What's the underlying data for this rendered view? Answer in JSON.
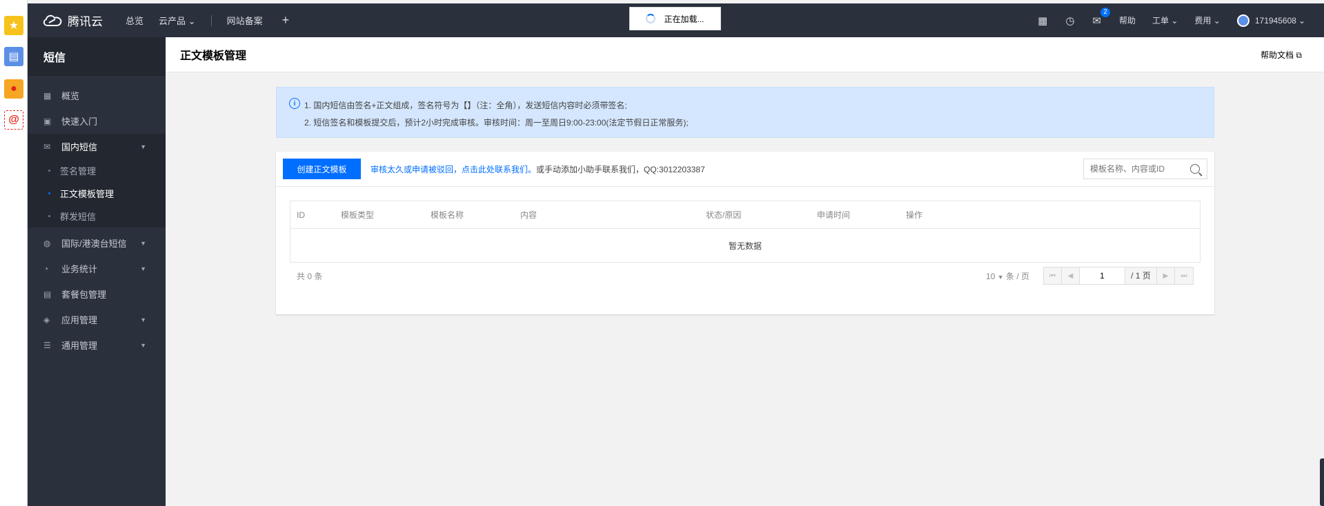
{
  "app_strip": {
    "icons": [
      "star-icon",
      "news-icon",
      "weibo-icon",
      "email-icon"
    ]
  },
  "topbar": {
    "logo_text": "腾讯云",
    "nav": [
      "总览",
      "云产品",
      "网站备案"
    ],
    "loading_text": "正在加载...",
    "mail_badge": "2",
    "help": "帮助",
    "ticket": "工单",
    "billing": "费用",
    "user_id": "171945608"
  },
  "sidebar": {
    "title": "短信",
    "items": [
      {
        "label": "概览"
      },
      {
        "label": "快速入门"
      },
      {
        "label": "国内短信"
      },
      {
        "label": "国际/港澳台短信"
      },
      {
        "label": "业务统计"
      },
      {
        "label": "套餐包管理"
      },
      {
        "label": "应用管理"
      },
      {
        "label": "通用管理"
      }
    ],
    "sub_items": [
      {
        "label": "签名管理"
      },
      {
        "label": "正文模板管理"
      },
      {
        "label": "群发短信"
      }
    ]
  },
  "page": {
    "title": "正文模板管理",
    "help_doc": "帮助文档"
  },
  "notice": {
    "line1": "1. 国内短信由签名+正文组成，签名符号为【】（注：全角），发送短信内容时必须带签名;",
    "line2": "2. 短信签名和模板提交后，预计2小时完成审核。审核时间：周一至周日9:00-23:00(法定节假日正常服务);"
  },
  "toolbar": {
    "create_button": "创建正文模板",
    "link_text": "审核太久或申请被驳回，点击此处联系我们。",
    "extra_text": "或手动添加小助手联系我们，QQ:3012203387",
    "search_placeholder": "模板名称、内容或ID"
  },
  "table": {
    "columns": [
      "ID",
      "模板类型",
      "模板名称",
      "内容",
      "状态/原因",
      "申请时间",
      "操作"
    ],
    "empty_text": "暂无数据"
  },
  "pager": {
    "total": "共 0 条",
    "page_size": "10",
    "page_size_unit": "条 / 页",
    "current_page": "1",
    "page_total": "/ 1 页"
  },
  "colors": {
    "primary": "#006eff",
    "topbar": "#2a303c",
    "notice_bg": "#d5e7ff"
  }
}
